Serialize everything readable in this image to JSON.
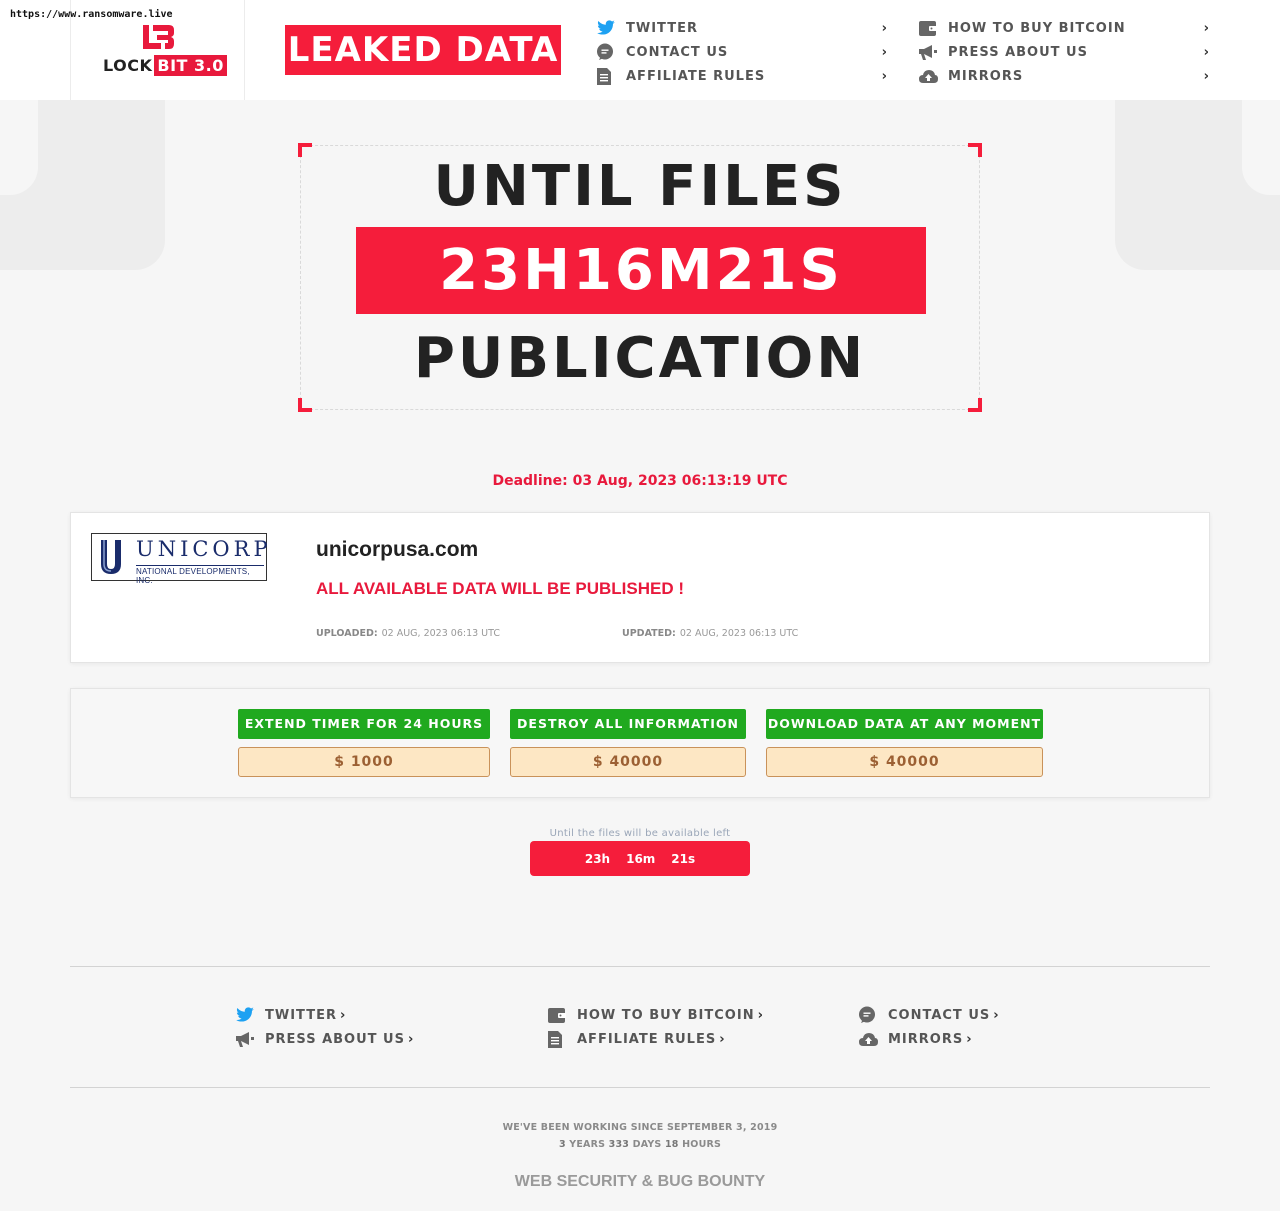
{
  "watermark": "https://www.ransomware.live",
  "brand": {
    "logo_main": "LOCK",
    "logo_accent": "BIT 3.0",
    "banner": "LEAKED DATA"
  },
  "nav": {
    "left": [
      {
        "icon": "twitter-icon",
        "label": "TWITTER"
      },
      {
        "icon": "chat-icon",
        "label": "CONTACT US"
      },
      {
        "icon": "document-icon",
        "label": "AFFILIATE RULES"
      }
    ],
    "right": [
      {
        "icon": "wallet-icon",
        "label": "HOW TO BUY BITCOIN"
      },
      {
        "icon": "megaphone-icon",
        "label": "PRESS ABOUT US"
      },
      {
        "icon": "cloud-upload-icon",
        "label": "MIRRORS"
      }
    ],
    "chevron": "›"
  },
  "countdown": {
    "line1": "UNTIL FILES",
    "timer": "23H16M21S",
    "line3": "PUBLICATION"
  },
  "deadline": "Deadline: 03 Aug, 2023 06:13:19 UTC",
  "victim": {
    "logo_name": "UNICORP",
    "logo_sub": "NATIONAL DEVELOPMENTS, INC.",
    "domain": "unicorpusa.com",
    "status": "ALL AVAILABLE DATA WILL BE PUBLISHED !",
    "uploaded_label": "UPLOADED:",
    "uploaded": "02 AUG, 2023 06:13 UTC",
    "updated_label": "UPDATED:",
    "updated": "02 AUG, 2023 06:13 UTC"
  },
  "actions": [
    {
      "label": "EXTEND TIMER FOR 24 HOURS",
      "price": "$ 1000"
    },
    {
      "label": "DESTROY ALL INFORMATION",
      "price": "$ 40000"
    },
    {
      "label": "DOWNLOAD DATA AT ANY MOMENT",
      "price": "$ 40000"
    }
  ],
  "small_timer": {
    "label": "Until the files will be available left",
    "h": "23h",
    "m": "16m",
    "s": "21s"
  },
  "footer": {
    "col1": [
      {
        "icon": "twitter-icon",
        "label": "TWITTER"
      },
      {
        "icon": "megaphone-icon",
        "label": "PRESS ABOUT US"
      }
    ],
    "col2": [
      {
        "icon": "wallet-icon",
        "label": "HOW TO BUY BITCOIN"
      },
      {
        "icon": "document-icon",
        "label": "AFFILIATE RULES"
      }
    ],
    "col3": [
      {
        "icon": "chat-icon",
        "label": "CONTACT US"
      },
      {
        "icon": "cloud-upload-icon",
        "label": "MIRRORS"
      }
    ],
    "since_line": "WE'VE BEEN WORKING SINCE SEPTEMBER 3, 2019",
    "years": "3",
    "years_label": "YEARS",
    "days": "333",
    "days_label": "DAYS",
    "hours": "18",
    "hours_label": "HOURS",
    "bottom_link": "WEB SECURITY & BUG BOUNTY"
  },
  "colors": {
    "accent": "#f51d3b",
    "green": "#20a91f",
    "twitter": "#1da1f2"
  }
}
